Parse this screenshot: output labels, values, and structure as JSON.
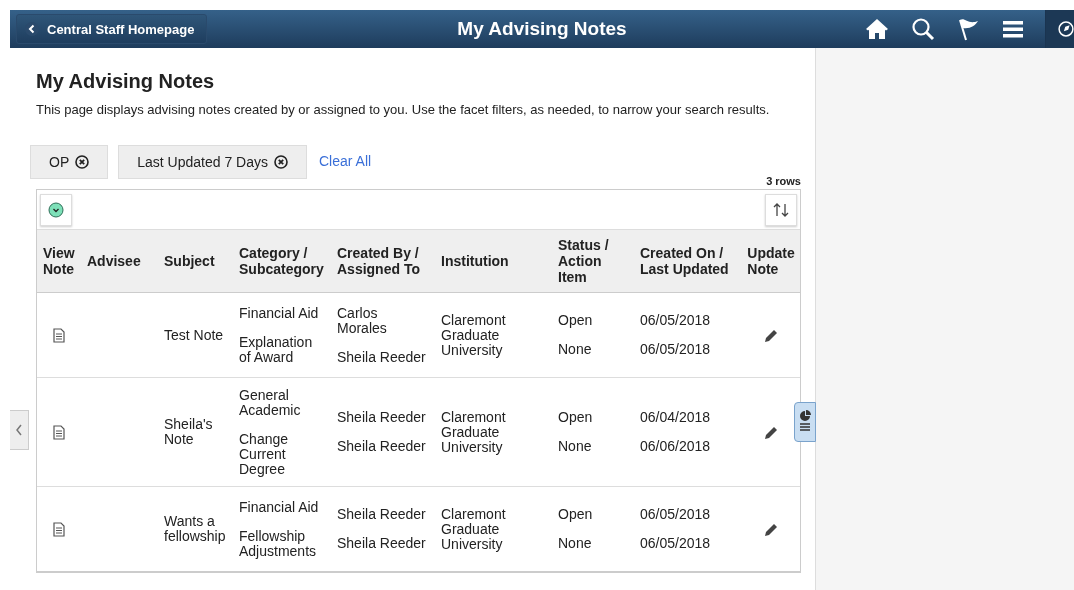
{
  "header": {
    "back_button": "Central Staff Homepage",
    "title": "My Advising Notes"
  },
  "page": {
    "heading": "My Advising Notes",
    "description": "This page displays advising notes created by or assigned to you. Use the facet filters, as needed, to narrow your search results."
  },
  "filters": [
    {
      "label": "OP"
    },
    {
      "label": "Last Updated 7 Days"
    }
  ],
  "clear_all": "Clear All",
  "row_count": "3 rows",
  "table": {
    "columns": [
      "View Note",
      "Advisee",
      "Subject",
      "Category / Subcategory",
      "Created By / Assigned To",
      "Institution",
      "Status / Action Item",
      "Created On / Last Updated",
      "Update Note"
    ],
    "rows": [
      {
        "subject": "Test Note",
        "category": "Financial Aid",
        "subcategory": "Explanation of Award",
        "created_by": "Carlos Morales",
        "assigned_to": "Sheila Reeder",
        "institution": "Claremont Graduate University",
        "status": "Open",
        "action_item": "None",
        "created_on": "06/05/2018",
        "last_updated": "06/05/2018"
      },
      {
        "subject": "Sheila's Note",
        "category": "General Academic",
        "subcategory": "Change Current Degree",
        "created_by": "Sheila Reeder",
        "assigned_to": "Sheila Reeder",
        "institution": "Claremont Graduate University",
        "status": "Open",
        "action_item": "None",
        "created_on": "06/04/2018",
        "last_updated": "06/06/2018"
      },
      {
        "subject": "Wants a fellowship",
        "category": "Financial Aid",
        "subcategory": "Fellowship Adjustments",
        "created_by": "Sheila Reeder",
        "assigned_to": "Sheila Reeder",
        "institution": "Claremont Graduate University",
        "status": "Open",
        "action_item": "None",
        "created_on": "06/05/2018",
        "last_updated": "06/05/2018"
      }
    ]
  }
}
